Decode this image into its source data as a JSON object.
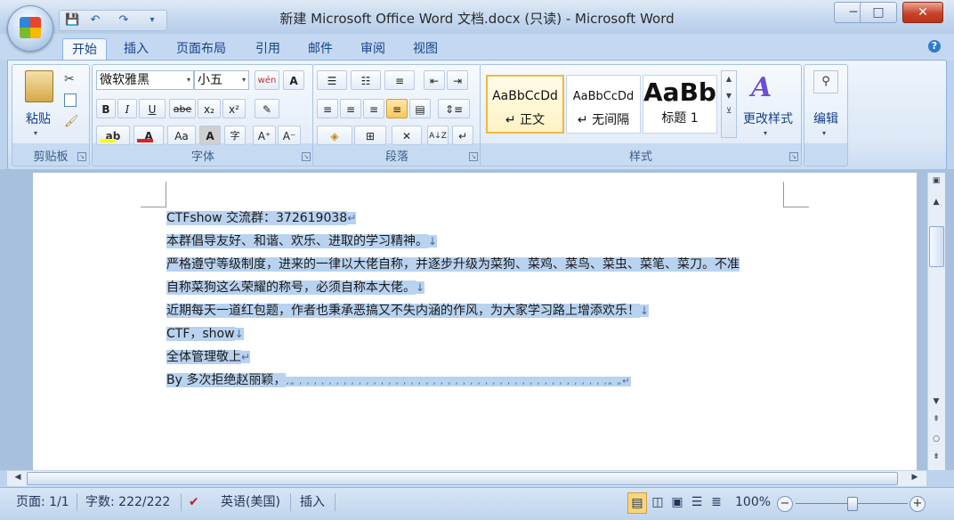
{
  "window": {
    "title": "新建 Microsoft Office Word 文档.docx (只读) - Microsoft Word",
    "minimize": "─",
    "maximize": "□",
    "close": "✕"
  },
  "qat": {
    "save": "💾",
    "undo": "↶",
    "redo": "↷",
    "customize": "▾"
  },
  "tabs": [
    "开始",
    "插入",
    "页面布局",
    "引用",
    "邮件",
    "审阅",
    "视图"
  ],
  "ribbon": {
    "clipboard": {
      "paste": "粘贴",
      "label": "剪贴板"
    },
    "font": {
      "name": "微软雅黑",
      "size": "小五",
      "label": "字体",
      "bold": "B",
      "italic": "I",
      "underline": "U",
      "strike": "abe",
      "sub": "x₂",
      "sup": "x²",
      "aa": "Aa",
      "grow": "A⁺",
      "shrink": "A⁻",
      "phonetic": "wén",
      "charborder": "A",
      "shade": "A",
      "enclose": "字"
    },
    "paragraph": {
      "label": "段落",
      "sort": "A↓Z",
      "marks": "↵"
    },
    "styles": {
      "label": "样式",
      "items": [
        {
          "preview": "AaBbCcDd",
          "name": "↵ 正文"
        },
        {
          "preview": "AaBbCcDd",
          "name": "↵ 无间隔"
        },
        {
          "preview": "AaBb",
          "name": "标题 1"
        }
      ],
      "change": "更改样式"
    },
    "editing": {
      "label": "编辑"
    }
  },
  "document": {
    "lines": [
      {
        "text": "CTFshow 交流群：372619038",
        "mark": "↵"
      },
      {
        "text": "本群倡导友好、和谐、欢乐、进取的学习精神。",
        "mark": "↓"
      },
      {
        "text": "严格遵守等级制度，进来的一律以大佬自称，并逐步升级为菜狗、菜鸡、菜鸟、菜虫、菜笔、菜刀。不准",
        "mark": ""
      },
      {
        "text": "自称菜狗这么荣耀的称号，必须自称本大佬。",
        "mark": "↓"
      },
      {
        "text": "近期每天一道红包题，作者也秉承恶搞又不失内涵的作风，为大家学习路上增添欢乐！",
        "mark": "↓"
      },
      {
        "text": "CTF，show",
        "mark": "↓"
      },
      {
        "text": "全体管理敬上",
        "mark": "↵"
      },
      {
        "text": "By  多次拒绝赵丽颖，",
        "mark": "‚„ ‚ ‚ ‚ ‚ ‚ ‚ ‚ ‚ ‚ ‚ ‚ ‚ ‚ ‚ ‚ ‚ ‚ ‚ ‚ ‚ ‚ ‚ ‚ ‚ ‚ ‚ ‚ ‚ ‚ ‚ ‚ ‚ ‚ ‚ ‚ ‚ ‚ ‚ ‚ ‚ ‚ ‚„ „↵"
      }
    ]
  },
  "status": {
    "page": "页面: 1/1",
    "words": "字数: 222/222",
    "language": "英语(美国)",
    "mode": "插入",
    "zoom": "100%"
  }
}
